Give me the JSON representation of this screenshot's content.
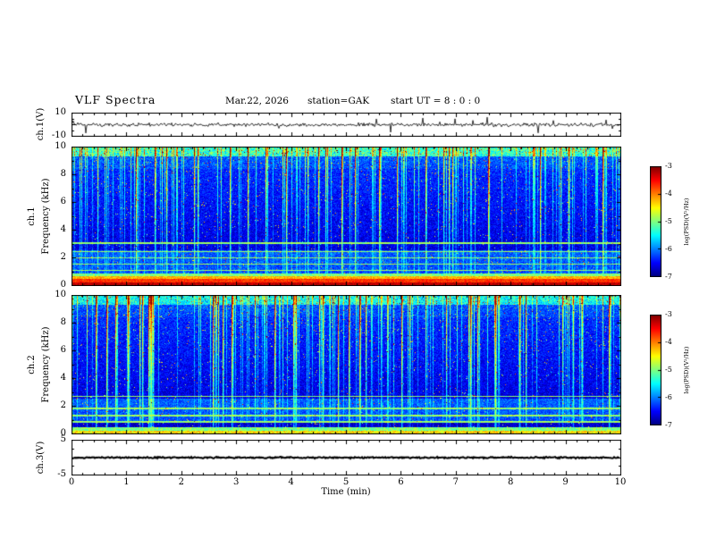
{
  "header": {
    "title": "VLF Spectra",
    "date": "Mar.22, 2026",
    "station": "station=GAK",
    "start_ut": "start UT =  8 : 0 : 0"
  },
  "x_axis": {
    "label": "Time (min)",
    "range": [
      0,
      10
    ],
    "ticks": [
      0,
      1,
      2,
      3,
      4,
      5,
      6,
      7,
      8,
      9,
      10
    ]
  },
  "colorbar": {
    "label": "log(PSD)(V²/Hz)",
    "ticks": [
      -3,
      -4,
      -5,
      -6,
      -7
    ],
    "range": [
      -7,
      -3
    ],
    "colormap": "jet"
  },
  "chart_data": [
    {
      "type": "line",
      "name": "ch.1 voltage time series",
      "ylabel": "ch.1(V)",
      "ylim": [
        -10,
        10
      ],
      "xlim": [
        0,
        10
      ],
      "y_ticks": [
        10,
        -10
      ],
      "description": "Black noisy trace centred on 0 V, typical excursions of about ±2 V with sparse spikes reaching roughly ±8 V across the 10 minute record.",
      "gen": {
        "seed": 20260322,
        "amp": 1.5,
        "spike_down": 0.012,
        "spike_up": 0.007,
        "spike_mag": 6,
        "y_sub": 4,
        "y_maj": 2
      }
    },
    {
      "type": "heatmap",
      "name": "ch.1 VLF spectrogram",
      "row_label": "ch.1",
      "ylabel": "Frequency (kHz)",
      "ylim": [
        0,
        10
      ],
      "xlim": [
        0,
        10
      ],
      "y_ticks": [
        0,
        2,
        4,
        6,
        8,
        10
      ],
      "value_range": [
        -7,
        -3
      ],
      "description": "Jet-colormap power spectral density 0-10 kHz vs 0-10 min: intense red/orange/yellow band below ~0.9 kHz, cyan horizontal interference lines near 1-3 kHz, dark blue background above 3 kHz crossed by many bright green/yellow vertical sferic streaks, bright green-yellow band at the very top near 10 kHz.",
      "gen": {
        "seed": 987611,
        "top_boost": 1.1,
        "h_lines": [
          1.15,
          1.6,
          2.05,
          2.5,
          3.1
        ],
        "low_bands": [
          {
            "f0": 0.0,
            "f1": 0.28,
            "v": -3.25,
            "n": 0.35
          },
          {
            "f0": 0.28,
            "f1": 0.52,
            "v": -3.7,
            "n": 0.4
          },
          {
            "f0": 0.52,
            "f1": 0.72,
            "v": -4.2,
            "n": 0.5
          },
          {
            "f0": 0.72,
            "f1": 0.9,
            "v": -5.0,
            "n": 0.6
          }
        ]
      }
    },
    {
      "type": "heatmap",
      "name": "ch.2 VLF spectrogram",
      "row_label": "ch.2",
      "ylabel": "Frequency (kHz)",
      "ylim": [
        0,
        10
      ],
      "xlim": [
        0,
        10
      ],
      "y_ticks": [
        0,
        2,
        4,
        6,
        8,
        10
      ],
      "value_range": [
        -7,
        -3
      ],
      "description": "Similar to ch.1 spectrogram but with a weaker green low-frequency band below ~0.5 kHz instead of the red band, and slightly fewer bright vertical streaks.",
      "gen": {
        "seed": 555123,
        "top_boost": 0.9,
        "h_lines": [
          0.95,
          1.4,
          1.9,
          2.75
        ],
        "low_bands": [
          {
            "f0": 0.0,
            "f1": 0.3,
            "v": -4.4,
            "n": 0.8
          },
          {
            "f0": 0.3,
            "f1": 0.55,
            "v": -5.0,
            "n": 0.7
          }
        ]
      }
    },
    {
      "type": "line",
      "name": "ch.3 voltage time series",
      "ylabel": "ch.3(V)",
      "ylim": [
        -5,
        5
      ],
      "xlim": [
        0,
        10
      ],
      "y_ticks": [
        5,
        -5
      ],
      "description": "Nearly flat dense black trace at approximately 0 V for the entire record.",
      "gen": {
        "seed": 77321,
        "amp": 0.22,
        "spike_down": 0,
        "spike_up": 0,
        "spike_mag": 0,
        "y_sub": 4,
        "y_maj": 2
      }
    }
  ]
}
